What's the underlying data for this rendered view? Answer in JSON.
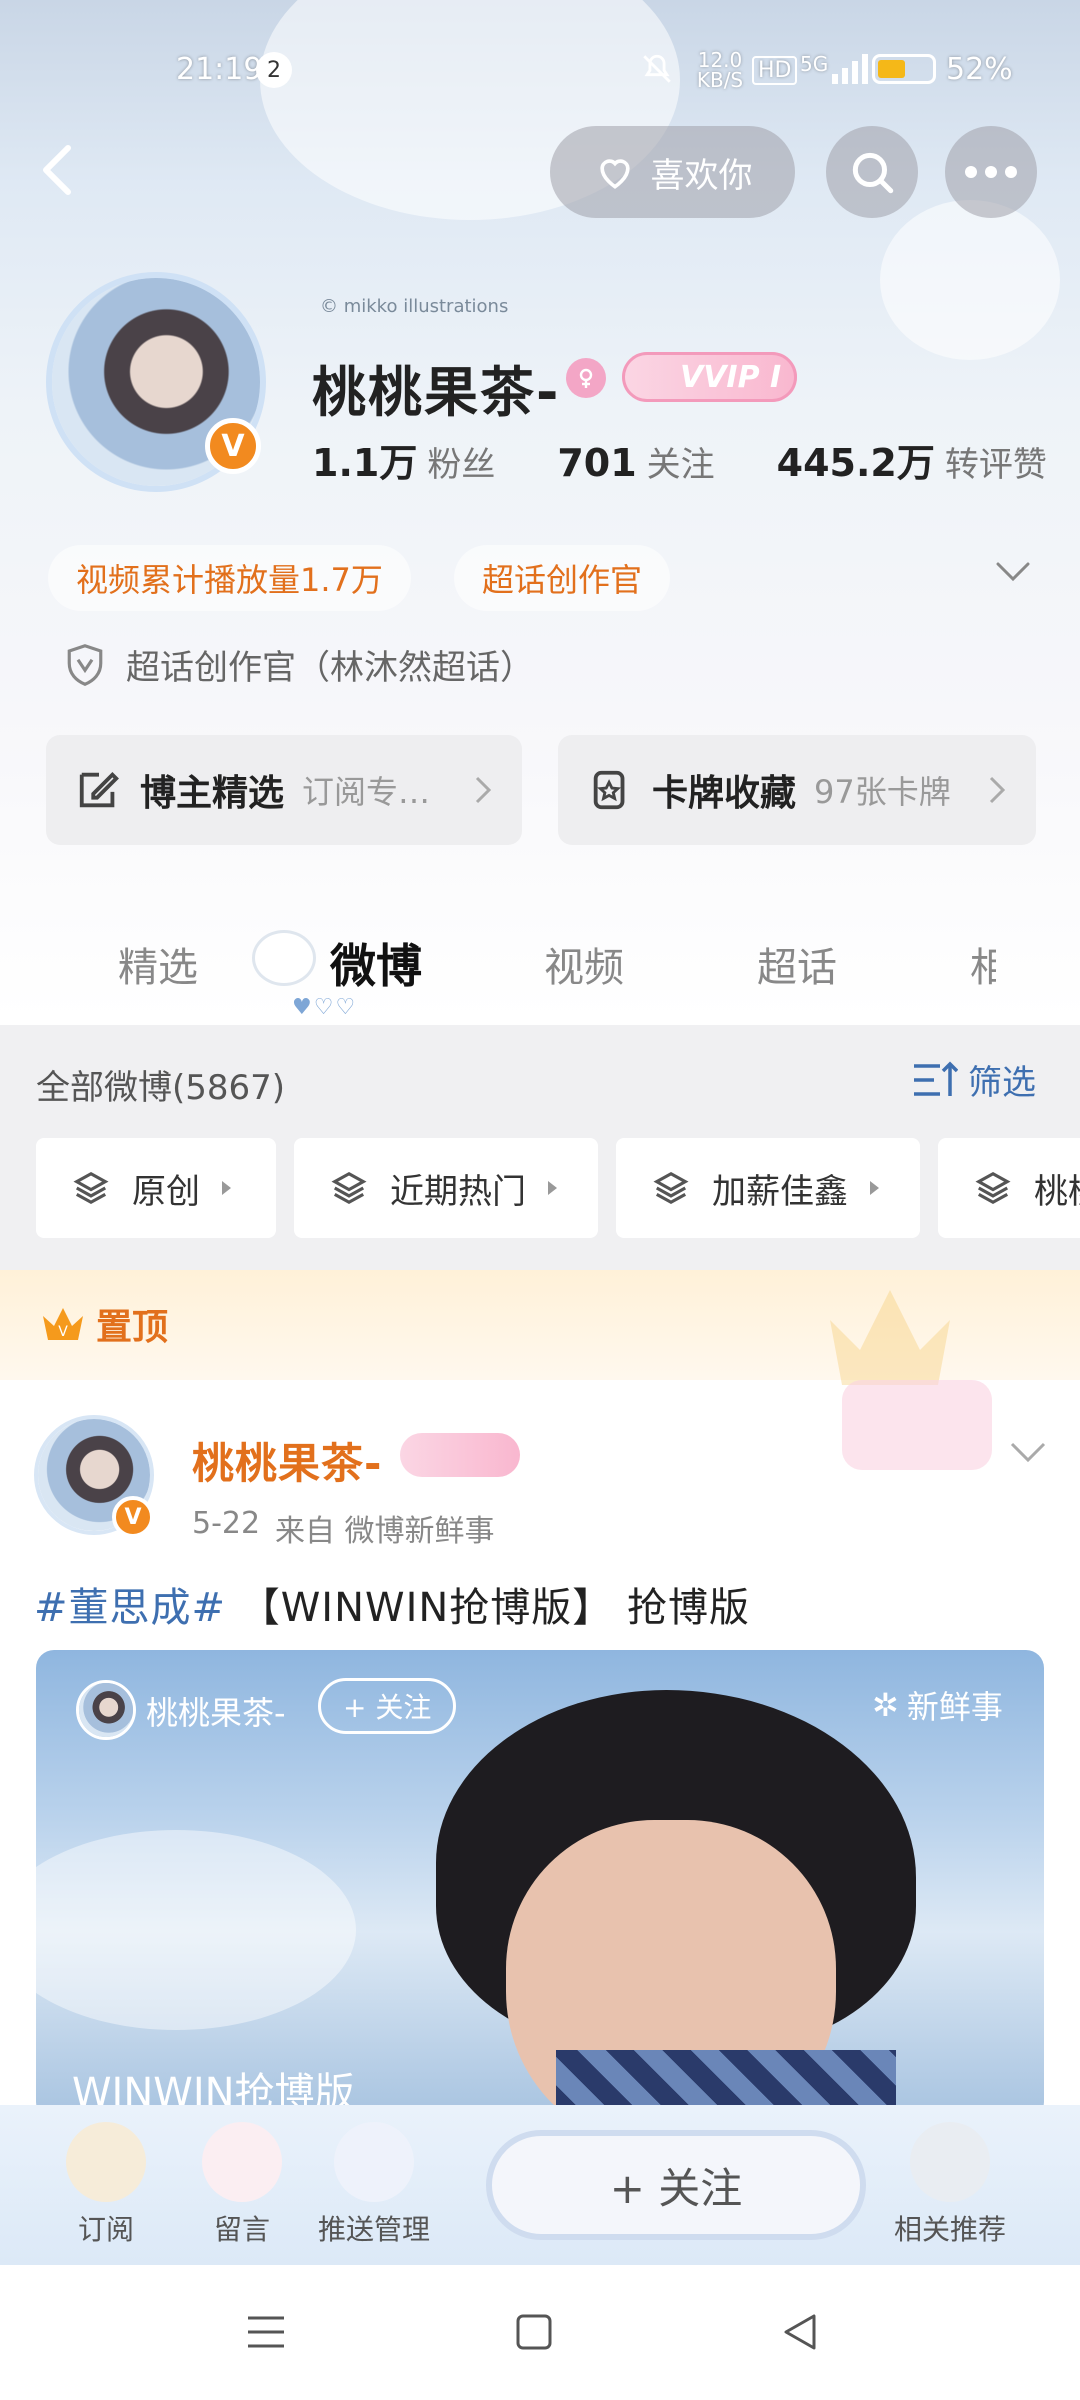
{
  "status_bar": {
    "time": "21:19",
    "notif_count": "2",
    "net_speed": "12.0 KB/S",
    "hd": "HD",
    "signal": "5G",
    "battery": "52%",
    "battery_level": 0.52
  },
  "header": {
    "like_you_label": "喜欢你",
    "credit": "© mikko illustrations"
  },
  "profile": {
    "name": "桃桃果茶-",
    "vip_label": "VVIP I",
    "stats": [
      {
        "num": "1.1万",
        "label": "粉丝"
      },
      {
        "num": "701",
        "label": "关注"
      },
      {
        "num": "445.2万",
        "label": "转评赞"
      }
    ],
    "tags": [
      "视频累计播放量1.7万",
      "超话创作官"
    ],
    "identity": "超话创作官（林沐然超话）"
  },
  "cards": [
    {
      "title": "博主精选",
      "sub": "订阅专…"
    },
    {
      "title": "卡牌收藏",
      "sub": "97张卡牌"
    }
  ],
  "tabs": [
    "精选",
    "微博",
    "视频",
    "超话",
    "相"
  ],
  "filter": {
    "all_label": "全部微博(5867)",
    "filter_label": "筛选",
    "chips": [
      "原创",
      "近期热门",
      "加薪佳鑫",
      "桃桃"
    ]
  },
  "pinned": {
    "label": "置顶"
  },
  "post": {
    "author": "桃桃果茶-",
    "date": "5-22",
    "source": "来自 微博新鲜事",
    "hashtag": "#董思成#",
    "text": "【WINWIN抢博版】 抢博版",
    "media_author": "桃桃果茶-",
    "media_follow": "+ 关注",
    "media_tag": "新鲜事",
    "media_caption": "WINWIN抢博版"
  },
  "bottom_bar": {
    "items": [
      "订阅",
      "留言",
      "推送管理"
    ],
    "follow": "+ 关注",
    "related": "相关推荐"
  },
  "colors": {
    "accent_orange": "#e2701c",
    "hashtag_blue": "#3e6fb0",
    "filter_blue": "#3e6fb0"
  }
}
